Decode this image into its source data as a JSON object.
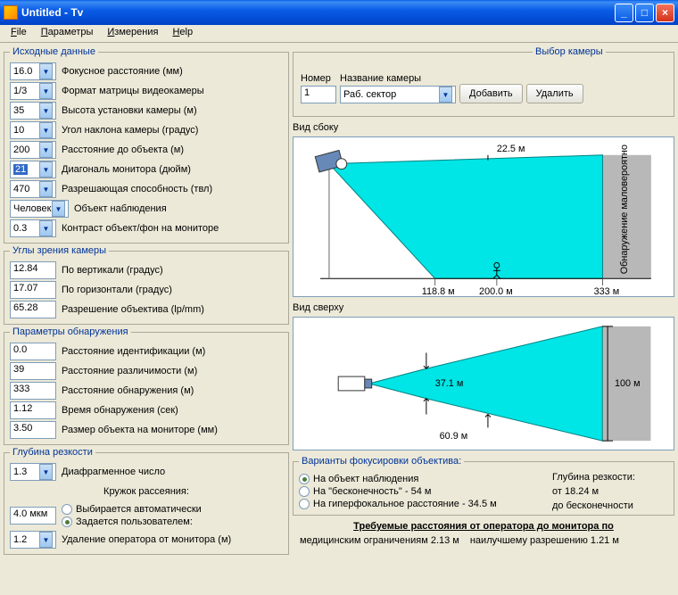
{
  "window": {
    "title": "Untitled - Tv"
  },
  "menu": {
    "file": "File",
    "params": "Параметры",
    "measure": "Измерения",
    "help": "Help"
  },
  "groups": {
    "source": "Исходные данные",
    "angles": "Углы зрения камеры",
    "detect": "Параметры обнаружения",
    "depth": "Глубина резкости",
    "camsel": "Выбор камеры",
    "focus": "Варианты фокусировки объектива:"
  },
  "src": {
    "focal": {
      "v": "16.0",
      "l": "Фокусное расстояние (мм)"
    },
    "matrix": {
      "v": "1/3",
      "l": "Формат матрицы видеокамеры"
    },
    "height": {
      "v": "35",
      "l": "Высота установки камеры (м)"
    },
    "tilt": {
      "v": "10",
      "l": "Угол наклона камеры (градус)"
    },
    "dist": {
      "v": "200",
      "l": "Расстояние до объекта (м)"
    },
    "diag": {
      "v": "21",
      "l": "Диагональ монитора (дюйм)"
    },
    "res": {
      "v": "470",
      "l": "Разрешающая способность (твл)"
    },
    "obj": {
      "v": "Человек",
      "l": "Объект наблюдения"
    },
    "contrast": {
      "v": "0.3",
      "l": "Контраст объект/фон на мониторе"
    }
  },
  "ang": {
    "vert": {
      "v": "12.84",
      "l": "По вертикали (градус)"
    },
    "horz": {
      "v": "17.07",
      "l": "По горизонтали (градус)"
    },
    "lens": {
      "v": "65.28",
      "l": "Разрешение объектива (lp/mm)"
    }
  },
  "det": {
    "ident": {
      "v": "0.0",
      "l": "Расстояние идентификации (м)"
    },
    "disc": {
      "v": "39",
      "l": "Расстояние различимости (м)"
    },
    "detect": {
      "v": "333",
      "l": "Расстояние обнаружения (м)"
    },
    "time": {
      "v": "1.12",
      "l": "Время обнаружения (сек)"
    },
    "size": {
      "v": "3.50",
      "l": "Размер объекта на мониторе (мм)"
    }
  },
  "dep": {
    "fnum": {
      "v": "1.3",
      "l": "Диафрагменное число"
    },
    "circle": "Кружок рассеяния:",
    "mkm": "4.0 мкм",
    "auto": "Выбирается автоматически",
    "user": "Задается пользователем:",
    "opdist": {
      "v": "1.2",
      "l": "Удаление оператора от монитора (м)"
    }
  },
  "cam": {
    "num_l": "Номер",
    "num_v": "1",
    "name_l": "Название камеры",
    "name_v": "Раб. сектор",
    "add": "Добавить",
    "del": "Удалить"
  },
  "diag": {
    "side": "Вид сбоку",
    "top": "Вид сверху",
    "d1": "22.5 м",
    "d2": "118.8 м",
    "d3": "200.0 м",
    "d4": "333 м",
    "d5": "37.1 м",
    "d6": "60.9 м",
    "d7": "100 м",
    "unlikely": "Обнаружение маловероятно"
  },
  "focus": {
    "obj": "На объект наблюдения",
    "inf": "На \"бесконечность\" -  54 м",
    "hyp": "На гиперфокальное расстояние -  34.5 м",
    "dof_l": "Глубина резкости:",
    "from": "от   18.24 м",
    "to": "до   бесконечности"
  },
  "req": {
    "title": "Требуемые расстояния от оператора до монитора по",
    "med": "медицинским ограничениям  2.13 м",
    "best": "наилучшему разрешению  1.21 м"
  }
}
